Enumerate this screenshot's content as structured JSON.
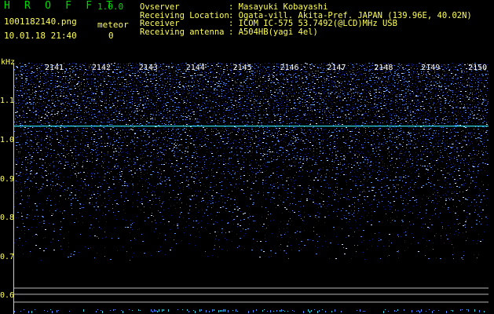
{
  "header": {
    "app_name": "H R O F F T",
    "version": "1.0.0",
    "file_name": "1001182140.png",
    "date_time": "10.01.18 21:40",
    "meteor_label": "meteor",
    "meteor_count": "0"
  },
  "info": [
    {
      "label": "Ovserver",
      "value": ": Masayuki Kobayashi"
    },
    {
      "label": "Receiving Location",
      "value": ": Ogata-vill. Akita-Pref. JAPAN (139.96E, 40.02N)"
    },
    {
      "label": "Receiver",
      "value": ": ICOM IC-575 53.7492(@LCD)MHz USB"
    },
    {
      "label": "Receiving antenna",
      "value": ": A504HB(yagi 4el)"
    }
  ],
  "chart_data": {
    "type": "heatmap",
    "yunit": "kHz",
    "yticks": [
      "1.1",
      "1.0",
      "0.9",
      "0.8",
      "0.7",
      "0.6"
    ],
    "xticks": [
      "2141",
      "2142",
      "2143",
      "2144",
      "2145",
      "2146",
      "2147",
      "2148",
      "2149",
      "2150"
    ],
    "ylim": [
      0.58,
      1.2
    ],
    "noise_profile": {
      "freq_khz": [
        1.2,
        1.1,
        1.0,
        0.9,
        0.8,
        0.7,
        0.62
      ],
      "level": [
        1.0,
        0.9,
        0.66,
        0.42,
        0.2,
        0.06,
        0.0
      ]
    },
    "carrier_khz": 1.037,
    "reference_lines_khz": [
      0.621,
      0.605,
      0.585
    ],
    "colors": {
      "noise_dim": "#0c1f8a",
      "noise_bright": "#4a8cff",
      "noise_hot": "#c8e0ff",
      "carrier": "#33d8e8",
      "reference": "#b8b8b8"
    }
  }
}
